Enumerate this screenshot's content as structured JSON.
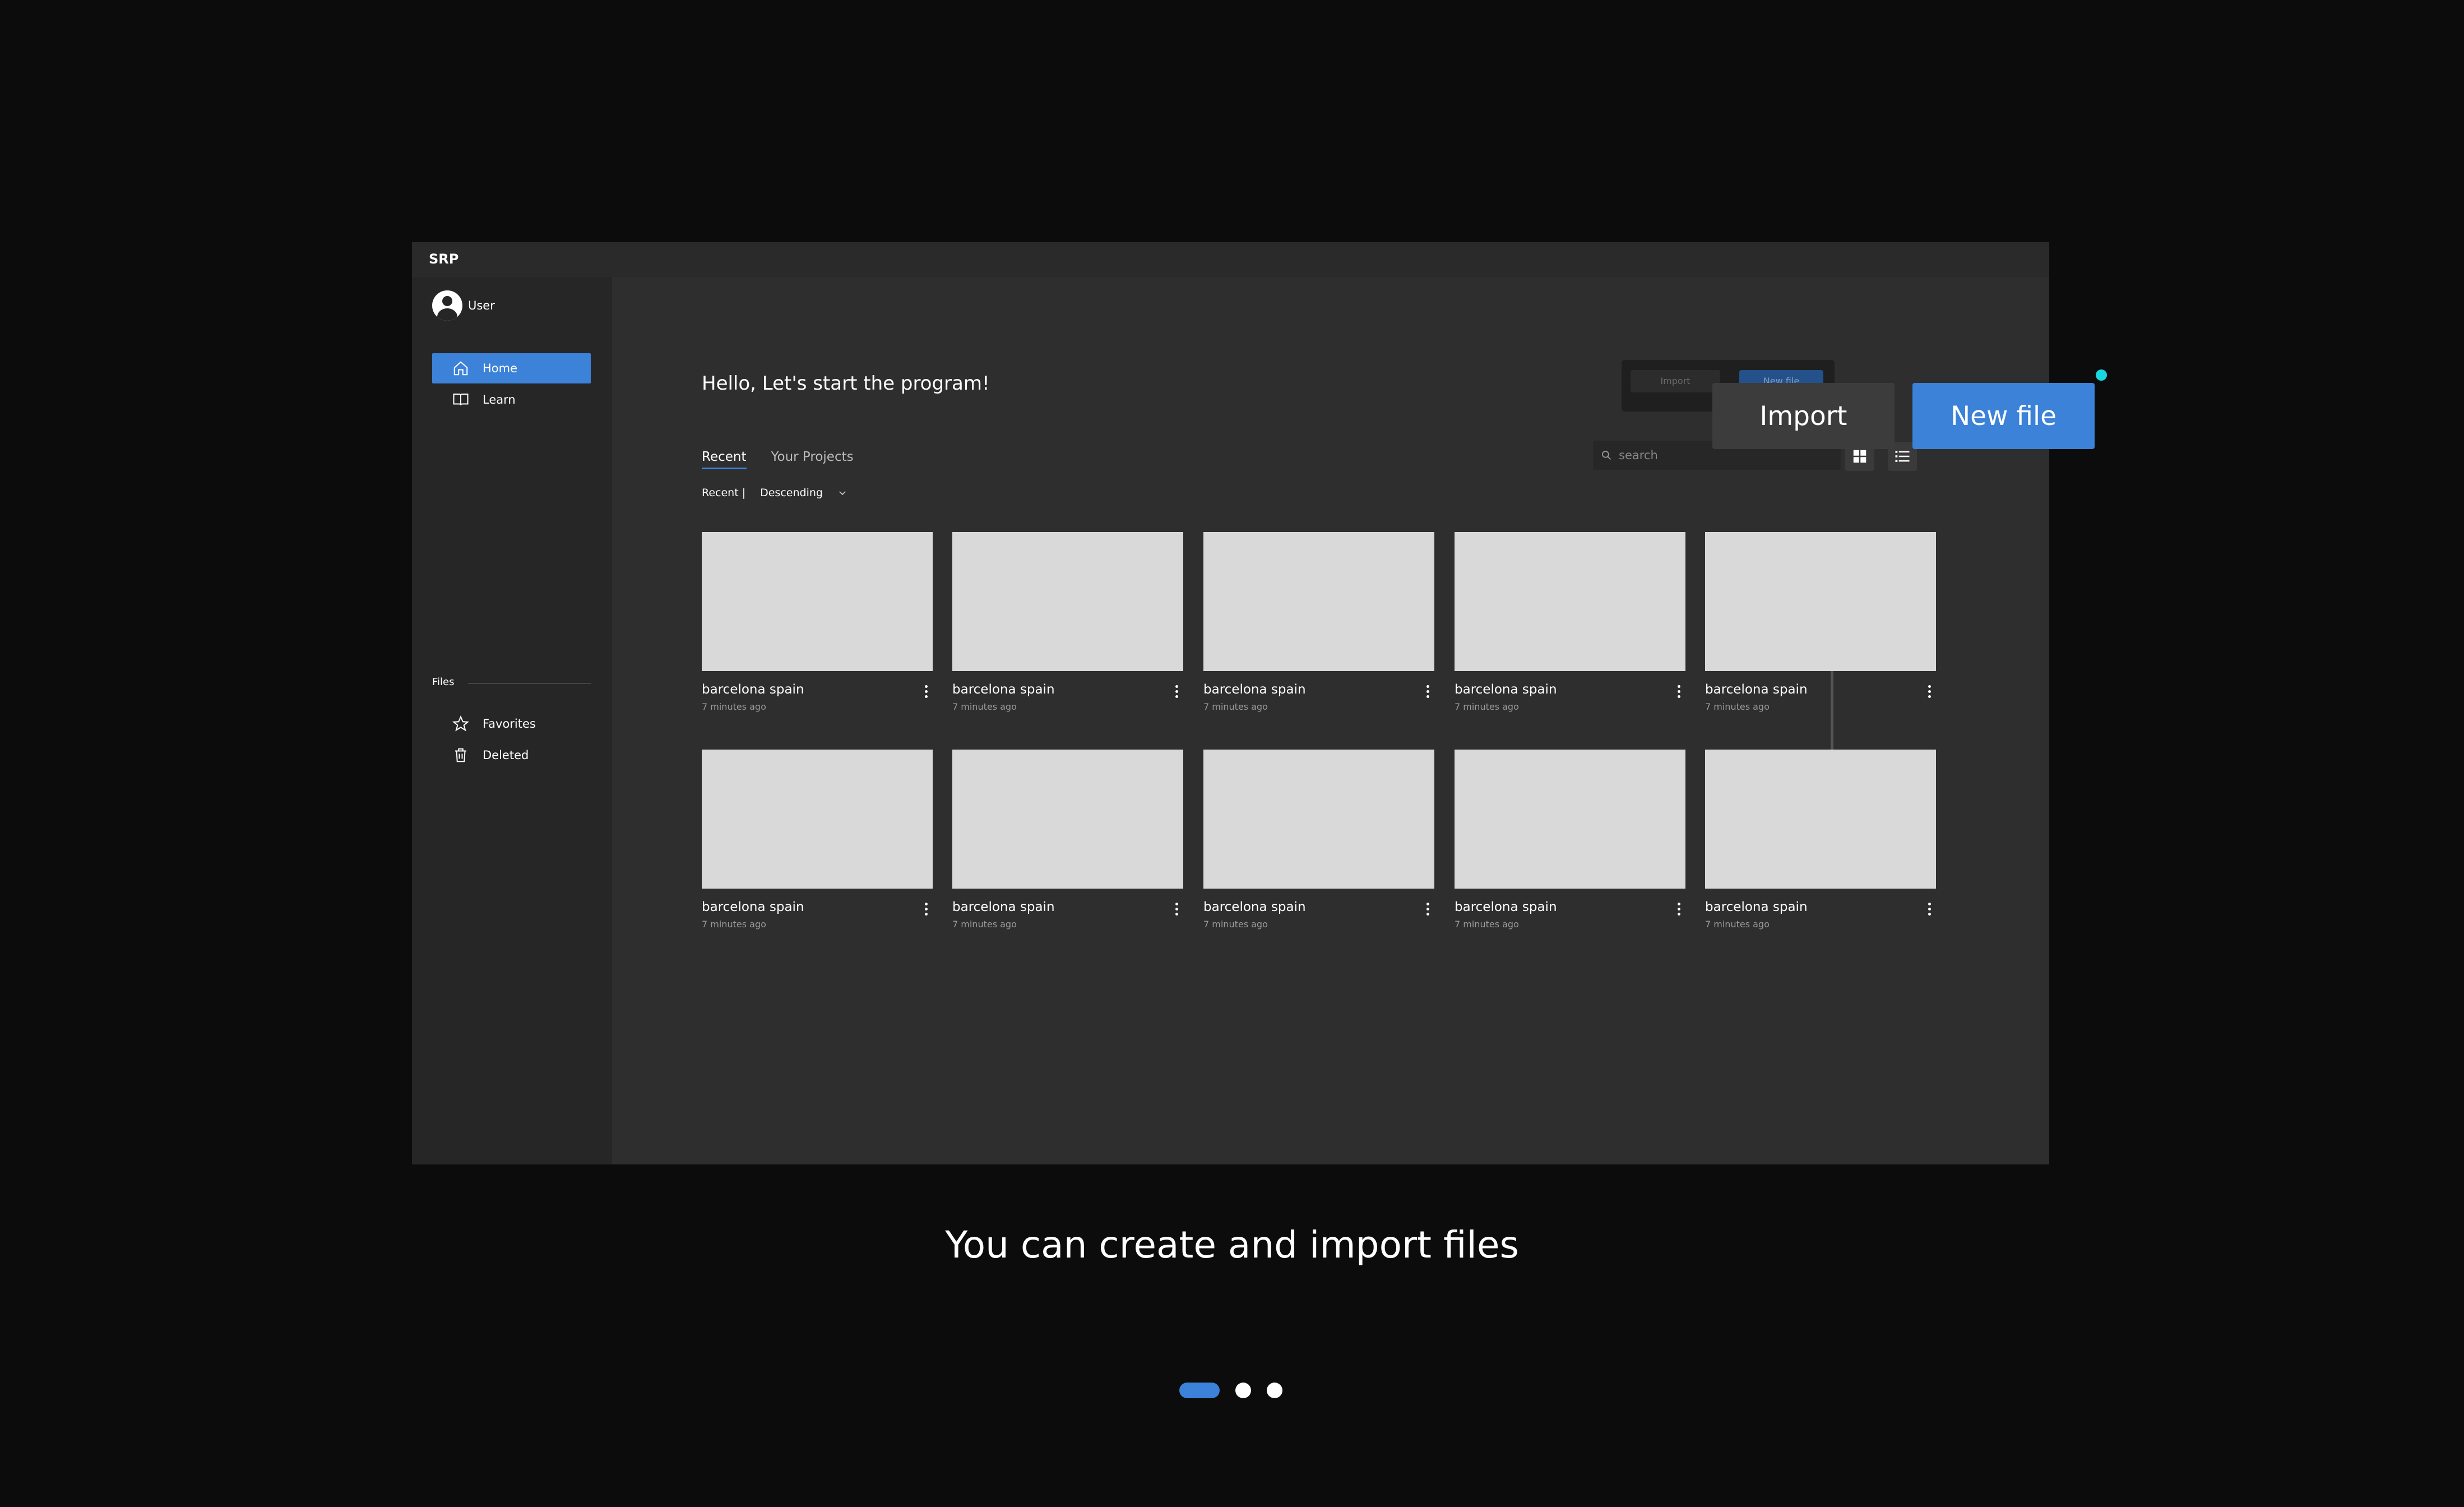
{
  "app": {
    "title": "SRP"
  },
  "sidebar": {
    "user": {
      "name": "User"
    },
    "nav": [
      {
        "label": "Home",
        "icon": "home-icon",
        "active": true
      },
      {
        "label": "Learn",
        "icon": "book-icon",
        "active": false
      }
    ],
    "files_heading": "Files",
    "files": [
      {
        "label": "Favorites",
        "icon": "star-icon"
      },
      {
        "label": "Deleted",
        "icon": "trash-icon"
      }
    ]
  },
  "main": {
    "greeting": "Hello, Let's start the program!",
    "mini_actions": {
      "import_label": "Import",
      "new_label": "New file"
    },
    "tabs": [
      {
        "label": "Recent",
        "active": true
      },
      {
        "label": "Your Projects",
        "active": false
      }
    ],
    "sort": {
      "label": "Recent |",
      "order": "Descending"
    },
    "search": {
      "placeholder": "search"
    },
    "cards": [
      {
        "title": "barcelona spain",
        "meta": "7 minutes ago"
      },
      {
        "title": "barcelona spain",
        "meta": "7 minutes ago"
      },
      {
        "title": "barcelona spain",
        "meta": "7 minutes ago"
      },
      {
        "title": "barcelona spain",
        "meta": "7 minutes ago"
      },
      {
        "title": "barcelona spain",
        "meta": "7 minutes ago"
      },
      {
        "title": "barcelona spain",
        "meta": "7 minutes ago"
      },
      {
        "title": "barcelona spain",
        "meta": "7 minutes ago"
      },
      {
        "title": "barcelona spain",
        "meta": "7 minutes ago"
      },
      {
        "title": "barcelona spain",
        "meta": "7 minutes ago"
      },
      {
        "title": "barcelona spain",
        "meta": "7 minutes ago"
      }
    ]
  },
  "callout": {
    "import_label": "Import",
    "new_label": "New file"
  },
  "caption": "You can create and import files",
  "pager": {
    "pages": 3,
    "current": 1
  },
  "colors": {
    "accent": "#3b82d8",
    "indicator": "#19d6e0",
    "background": "#0c0c0c"
  }
}
